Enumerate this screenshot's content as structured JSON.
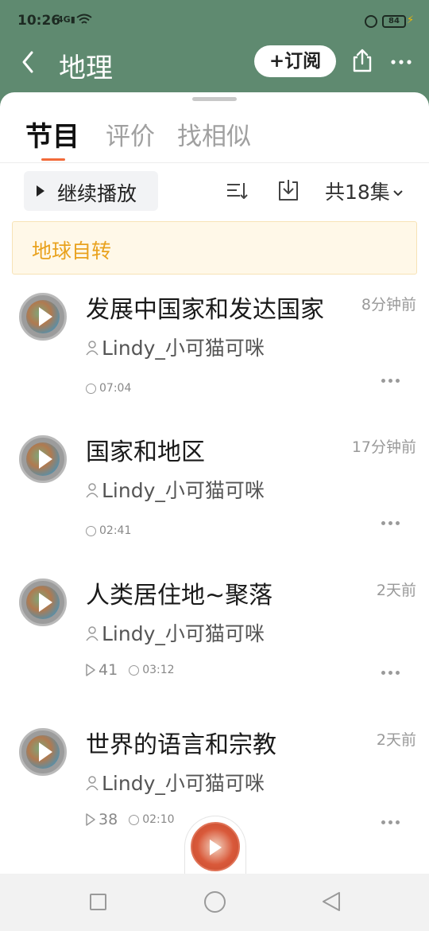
{
  "status": {
    "time": "10:26",
    "signal": "4G",
    "battery": "84"
  },
  "header": {
    "title": "地理",
    "subscribe_label": "+订阅"
  },
  "tabs": [
    {
      "label": "节目",
      "active": true
    },
    {
      "label": "评价",
      "active": false
    },
    {
      "label": "找相似",
      "active": false
    }
  ],
  "toolbar": {
    "continue_label": "继续播放",
    "count_label": "共18集"
  },
  "notice": {
    "text": "地球自转"
  },
  "episodes": [
    {
      "title": "发展中国家和发达国家",
      "ago": "8分钟前",
      "author": "Lindy_小可猫可咪",
      "plays": "",
      "duration": "07:04"
    },
    {
      "title": "国家和地区",
      "ago": "17分钟前",
      "author": "Lindy_小可猫可咪",
      "plays": "",
      "duration": "02:41"
    },
    {
      "title": "人类居住地~聚落",
      "ago": "2天前",
      "author": "Lindy_小可猫可咪",
      "plays": "41",
      "duration": "03:12"
    },
    {
      "title": "世界的语言和宗教",
      "ago": "2天前",
      "author": "Lindy_小可猫可咪",
      "plays": "38",
      "duration": "02:10"
    }
  ],
  "colors": {
    "header_bg": "#5f8a70",
    "accent": "#f26b3a",
    "notice_text": "#e9a21e"
  }
}
